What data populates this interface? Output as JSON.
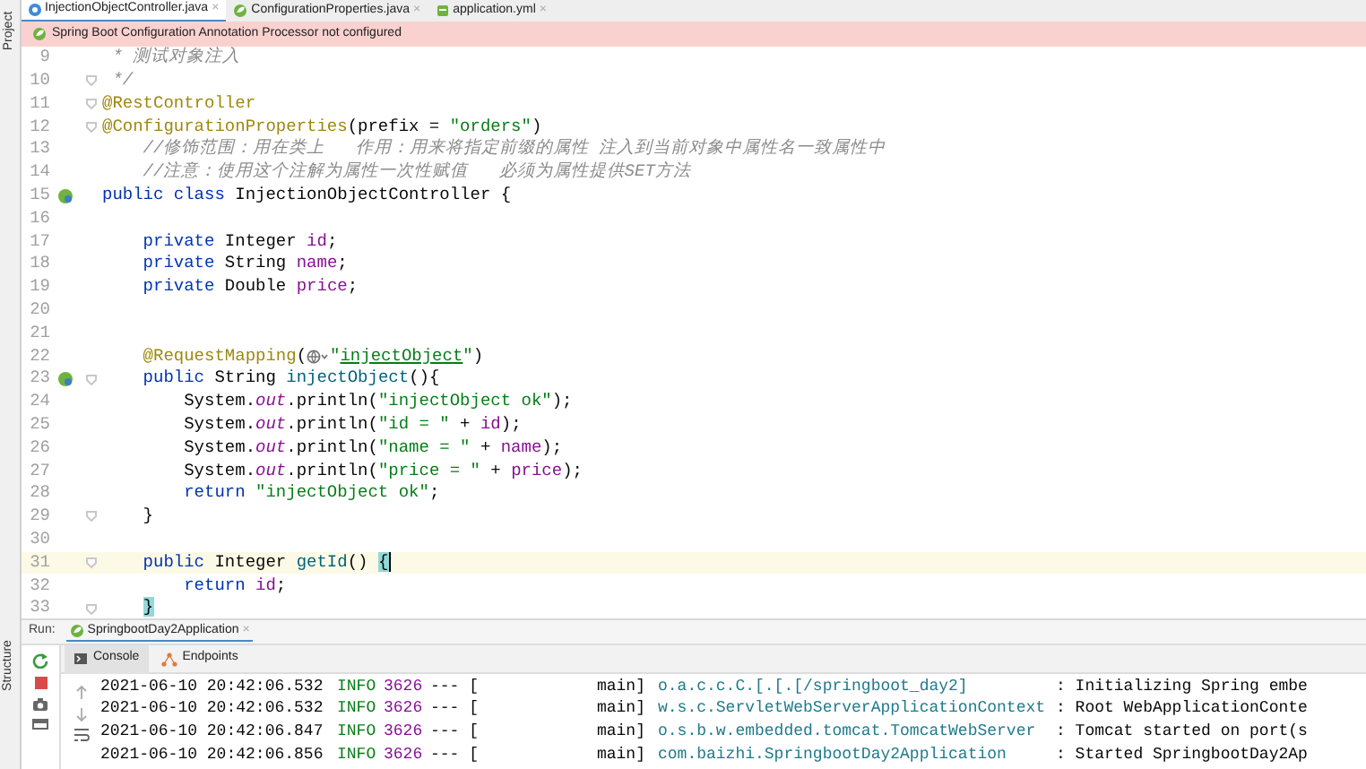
{
  "side_labels": [
    "Project",
    "Structure"
  ],
  "tabs": [
    {
      "label": "InjectionObjectController.java",
      "selected": true,
      "close": "×"
    },
    {
      "label": "ConfigurationProperties.java",
      "selected": false,
      "close": "×"
    },
    {
      "label": "application.yml",
      "selected": false,
      "close": "×"
    }
  ],
  "banner": {
    "text": "Spring Boot Configuration Annotation Processor not configured"
  },
  "code_lines": [
    {
      "number": "9",
      "bean": false,
      "fold": false,
      "current": false,
      "tokens": [
        {
          "text": " * 测试对象注入",
          "kind": "comment"
        }
      ]
    },
    {
      "number": "10",
      "bean": false,
      "fold": true,
      "current": false,
      "tokens": [
        {
          "text": " */",
          "kind": "comment"
        }
      ]
    },
    {
      "number": "11",
      "bean": false,
      "fold": true,
      "current": false,
      "tokens": [
        {
          "text": "@RestController",
          "kind": "annotation"
        }
      ]
    },
    {
      "number": "12",
      "bean": false,
      "fold": true,
      "current": false,
      "tokens": [
        {
          "text": "@ConfigurationProperties",
          "kind": "annotation"
        },
        {
          "text": "(prefix = ",
          "kind": "plain"
        },
        {
          "text": "\"orders\"",
          "kind": "string"
        },
        {
          "text": ")",
          "kind": "plain"
        }
      ]
    },
    {
      "number": "13",
      "bean": false,
      "fold": false,
      "current": false,
      "tokens": [
        {
          "text": "    //修饰范围：用在类上   作用：用来将指定前缀的属性 注入到当前对象中属性名一致属性中",
          "kind": "comment"
        }
      ]
    },
    {
      "number": "14",
      "bean": false,
      "fold": false,
      "current": false,
      "tokens": [
        {
          "text": "    //注意：使用这个注解为属性一次性赋值   必须为属性提供SET方法",
          "kind": "comment"
        }
      ]
    },
    {
      "number": "15",
      "bean": true,
      "fold": false,
      "current": false,
      "tokens": [
        {
          "text": "public class ",
          "kind": "keyword"
        },
        {
          "text": "InjectionObjectController {",
          "kind": "plain"
        }
      ]
    },
    {
      "number": "16",
      "bean": false,
      "fold": false,
      "current": false
    },
    {
      "number": "17",
      "bean": false,
      "fold": false,
      "current": false,
      "tokens": [
        {
          "text": "    private ",
          "kind": "keyword"
        },
        {
          "text": "Integer ",
          "kind": "plain"
        },
        {
          "text": "id",
          "kind": "field"
        },
        {
          "text": ";",
          "kind": "plain"
        }
      ]
    },
    {
      "number": "18",
      "bean": false,
      "fold": false,
      "current": false,
      "tokens": [
        {
          "text": "    private ",
          "kind": "keyword"
        },
        {
          "text": "String ",
          "kind": "plain"
        },
        {
          "text": "name",
          "kind": "field"
        },
        {
          "text": ";",
          "kind": "plain"
        }
      ]
    },
    {
      "number": "19",
      "bean": false,
      "fold": false,
      "current": false,
      "tokens": [
        {
          "text": "    private ",
          "kind": "keyword"
        },
        {
          "text": "Double ",
          "kind": "plain"
        },
        {
          "text": "price",
          "kind": "field"
        },
        {
          "text": ";",
          "kind": "plain"
        }
      ]
    },
    {
      "number": "20",
      "bean": false,
      "fold": false,
      "current": false
    },
    {
      "number": "21",
      "bean": false,
      "fold": false,
      "current": false
    },
    {
      "number": "22",
      "bean": false,
      "fold": false,
      "current": false,
      "tokens": [
        {
          "text": "    @RequestMapping",
          "kind": "annotation"
        },
        {
          "text": "(",
          "kind": "plain"
        },
        {
          "kind": "inlay"
        },
        {
          "text": "\"",
          "kind": "string"
        },
        {
          "text": "injectObject",
          "kind": "link-string"
        },
        {
          "text": "\"",
          "kind": "string"
        },
        {
          "text": ")",
          "kind": "plain"
        }
      ]
    },
    {
      "number": "23",
      "bean": true,
      "fold": true,
      "current": false,
      "tokens": [
        {
          "text": "    public ",
          "kind": "keyword"
        },
        {
          "text": "String ",
          "kind": "plain"
        },
        {
          "text": "injectObject",
          "kind": "method"
        },
        {
          "text": "(){",
          "kind": "plain"
        }
      ]
    },
    {
      "number": "24",
      "bean": false,
      "fold": false,
      "current": false,
      "tokens": [
        {
          "text": "        System.",
          "kind": "plain"
        },
        {
          "text": "out",
          "kind": "static"
        },
        {
          "text": ".println(",
          "kind": "plain"
        },
        {
          "text": "\"injectObject ok\"",
          "kind": "string"
        },
        {
          "text": ");",
          "kind": "plain"
        }
      ]
    },
    {
      "number": "25",
      "bean": false,
      "fold": false,
      "current": false,
      "tokens": [
        {
          "text": "        System.",
          "kind": "plain"
        },
        {
          "text": "out",
          "kind": "static"
        },
        {
          "text": ".println(",
          "kind": "plain"
        },
        {
          "text": "\"id = \"",
          "kind": "string"
        },
        {
          "text": " + ",
          "kind": "plain"
        },
        {
          "text": "id",
          "kind": "field"
        },
        {
          "text": ");",
          "kind": "plain"
        }
      ]
    },
    {
      "number": "26",
      "bean": false,
      "fold": false,
      "current": false,
      "tokens": [
        {
          "text": "        System.",
          "kind": "plain"
        },
        {
          "text": "out",
          "kind": "static"
        },
        {
          "text": ".println(",
          "kind": "plain"
        },
        {
          "text": "\"name = \"",
          "kind": "string"
        },
        {
          "text": " + ",
          "kind": "plain"
        },
        {
          "text": "name",
          "kind": "field"
        },
        {
          "text": ");",
          "kind": "plain"
        }
      ]
    },
    {
      "number": "27",
      "bean": false,
      "fold": false,
      "current": false,
      "tokens": [
        {
          "text": "        System.",
          "kind": "plain"
        },
        {
          "text": "out",
          "kind": "static"
        },
        {
          "text": ".println(",
          "kind": "plain"
        },
        {
          "text": "\"price = \"",
          "kind": "string"
        },
        {
          "text": " + ",
          "kind": "plain"
        },
        {
          "text": "price",
          "kind": "field"
        },
        {
          "text": ");",
          "kind": "plain"
        }
      ]
    },
    {
      "number": "28",
      "bean": false,
      "fold": false,
      "current": false,
      "tokens": [
        {
          "text": "        return ",
          "kind": "keyword"
        },
        {
          "text": "\"injectObject ok\"",
          "kind": "string"
        },
        {
          "text": ";",
          "kind": "plain"
        }
      ]
    },
    {
      "number": "29",
      "bean": false,
      "fold": true,
      "current": false,
      "tokens": [
        {
          "text": "    }",
          "kind": "plain"
        }
      ]
    },
    {
      "number": "30",
      "bean": false,
      "fold": false,
      "current": false
    },
    {
      "number": "31",
      "bean": false,
      "fold": true,
      "current": true,
      "tokens": [
        {
          "text": "    public ",
          "kind": "keyword"
        },
        {
          "text": "Integer ",
          "kind": "plain"
        },
        {
          "text": "getId",
          "kind": "method"
        },
        {
          "text": "() ",
          "kind": "plain"
        },
        {
          "text": "{",
          "kind": "brace-match"
        }
      ]
    },
    {
      "number": "32",
      "bean": false,
      "fold": false,
      "current": false,
      "tokens": [
        {
          "text": "        return ",
          "kind": "keyword"
        },
        {
          "text": "id",
          "kind": "field"
        },
        {
          "text": ";",
          "kind": "plain"
        }
      ]
    },
    {
      "number": "33",
      "bean": false,
      "fold": true,
      "current": false,
      "tokens": [
        {
          "text": "    }",
          "kind": "brace-match"
        }
      ]
    }
  ],
  "run_panel": {
    "label": "Run:",
    "config": {
      "label": "SpringbootDay2Application",
      "close": "×"
    },
    "tabs": [
      {
        "label": "Console",
        "selected": true
      },
      {
        "label": "Endpoints",
        "selected": false
      }
    ],
    "console_lines": [
      {
        "timestamp": "2021-06-10 20:42:06.532",
        "level": "INFO",
        "pid": "3626",
        "sep": "--- [",
        "thread": "main]",
        "logger": "o.a.c.c.C.[.[.[/springboot_day2]",
        "message": ": Initializing Spring embe"
      },
      {
        "timestamp": "2021-06-10 20:42:06.532",
        "level": "INFO",
        "pid": "3626",
        "sep": "--- [",
        "thread": "main]",
        "logger": "w.s.c.ServletWebServerApplicationContext",
        "message": ": Root WebApplicationConte"
      },
      {
        "timestamp": "2021-06-10 20:42:06.847",
        "level": "INFO",
        "pid": "3626",
        "sep": "--- [",
        "thread": "main]",
        "logger": "o.s.b.w.embedded.tomcat.TomcatWebServer",
        "message": ": Tomcat started on port(s"
      },
      {
        "timestamp": "2021-06-10 20:42:06.856",
        "level": "INFO",
        "pid": "3626",
        "sep": "--- [",
        "thread": "main]",
        "logger": "com.baizhi.SpringbootDay2Application",
        "message": ": Started SpringbootDay2Ap"
      }
    ]
  }
}
